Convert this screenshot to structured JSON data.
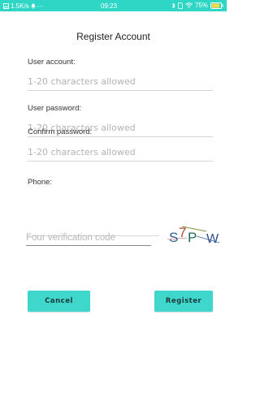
{
  "status_bar": {
    "speed": "1.5K/s",
    "dots": "···",
    "time": "09:23",
    "battery": "75%"
  },
  "page": {
    "title": "Register Account"
  },
  "form": {
    "account": {
      "label": "User account:",
      "placeholder": "1-20 characters allowed",
      "value": ""
    },
    "password": {
      "label": "User password:",
      "placeholder": "1-20 characters allowed",
      "value": ""
    },
    "confirm": {
      "label": "Confirm password:",
      "placeholder": "1-20 characters allowed",
      "value": ""
    },
    "phone": {
      "label": "Phone:",
      "placeholder": "",
      "value": ""
    },
    "verification": {
      "placeholder": "Four verification code",
      "value": ""
    },
    "captcha_text": "S7PW"
  },
  "buttons": {
    "cancel": "Cancel",
    "register": "Register"
  },
  "colors": {
    "status_bar": "#2fd6c6",
    "button": "#3fd6cc"
  },
  "icons": [
    "image-icon",
    "notification-icon",
    "bluetooth-icon",
    "sim-icon",
    "wifi-icon",
    "battery-icon"
  ]
}
